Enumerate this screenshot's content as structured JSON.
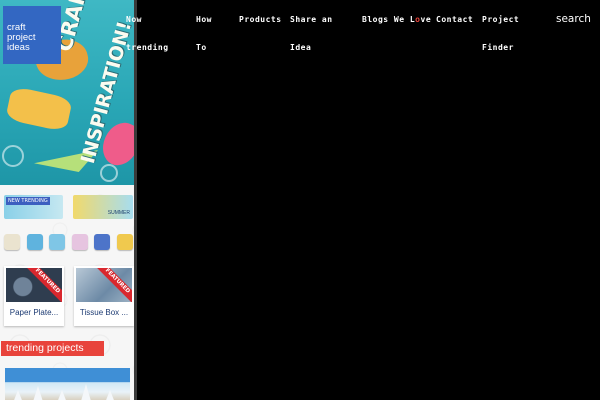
{
  "logo": {
    "lines": [
      "craft",
      "project",
      "ideas"
    ]
  },
  "hero": {
    "title_line1": "CRAFTY",
    "title_line2": "INSPIRATION!"
  },
  "banners": [
    {
      "tag": "NEW TRENDING",
      "caption": ""
    },
    {
      "tag": "",
      "caption": "SUMMER"
    }
  ],
  "featured_cards": [
    {
      "ribbon": "FEATURED",
      "caption": "Paper Plate..."
    },
    {
      "ribbon": "FEATURED",
      "caption": "Tissue Box ..."
    }
  ],
  "trending_label": "trending projects",
  "nav": {
    "items": [
      {
        "line1": "Now",
        "line2": "trending"
      },
      {
        "line1": "How",
        "line2": "To"
      },
      {
        "line1": "Products",
        "line2": ""
      },
      {
        "line1": "Share an",
        "line2": "Idea"
      },
      {
        "line1_pre": "Blogs We L",
        "line1_o": "o",
        "line1_post": "ve",
        "line2": ""
      },
      {
        "line1": "Contact",
        "line2": ""
      },
      {
        "line1": "Project",
        "line2": "Finder"
      }
    ],
    "search_label": "search"
  },
  "colors": {
    "logo_bg": "#3367c2",
    "accent_red": "#e8433b",
    "page_bg": "#000000"
  }
}
